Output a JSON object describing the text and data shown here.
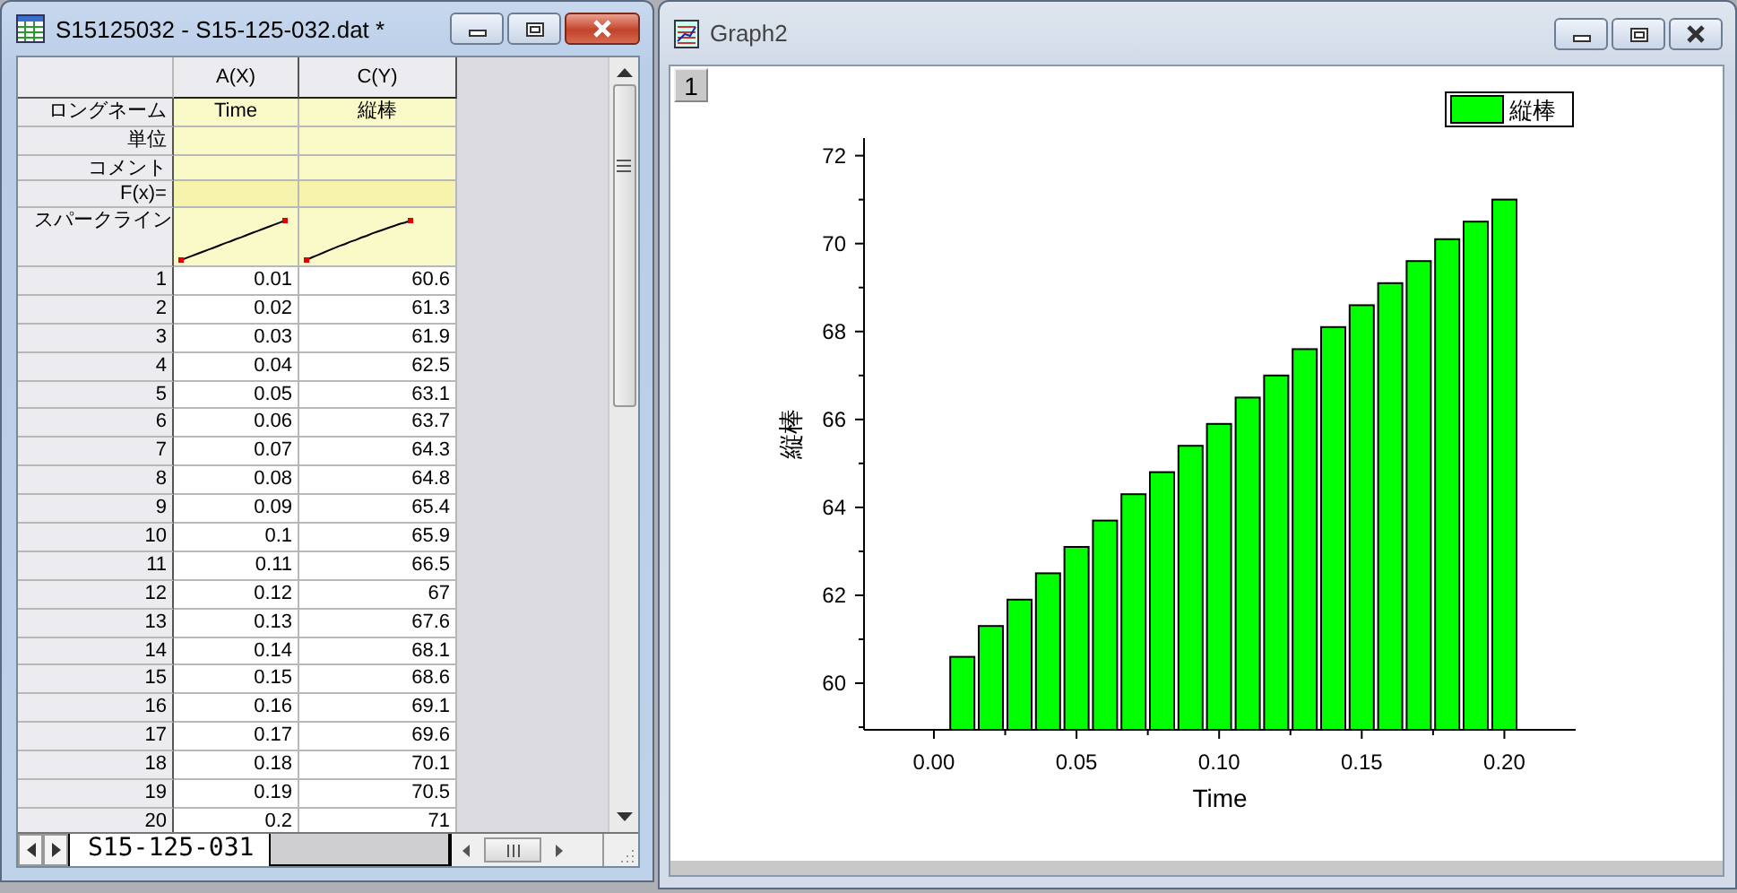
{
  "worksheet_window": {
    "title": "S15125032 - S15-125-032.dat *",
    "columns": [
      {
        "header": "A(X)",
        "long_name": "Time"
      },
      {
        "header": "C(Y)",
        "long_name": "縦棒"
      }
    ],
    "label_rows": [
      {
        "label": "ロングネーム",
        "kind": "text"
      },
      {
        "label": "単位",
        "kind": "text"
      },
      {
        "label": "コメント",
        "kind": "text"
      },
      {
        "label": "F(x)=",
        "kind": "formula"
      },
      {
        "label": "スパークライン",
        "kind": "sparkline"
      }
    ],
    "rows": [
      {
        "index": "1",
        "cells": [
          "0.01",
          "60.6"
        ]
      },
      {
        "index": "2",
        "cells": [
          "0.02",
          "61.3"
        ]
      },
      {
        "index": "3",
        "cells": [
          "0.03",
          "61.9"
        ]
      },
      {
        "index": "4",
        "cells": [
          "0.04",
          "62.5"
        ]
      },
      {
        "index": "5",
        "cells": [
          "0.05",
          "63.1"
        ]
      },
      {
        "index": "6",
        "cells": [
          "0.06",
          "63.7"
        ]
      },
      {
        "index": "7",
        "cells": [
          "0.07",
          "64.3"
        ]
      },
      {
        "index": "8",
        "cells": [
          "0.08",
          "64.8"
        ]
      },
      {
        "index": "9",
        "cells": [
          "0.09",
          "65.4"
        ]
      },
      {
        "index": "10",
        "cells": [
          "0.1",
          "65.9"
        ]
      },
      {
        "index": "11",
        "cells": [
          "0.11",
          "66.5"
        ]
      },
      {
        "index": "12",
        "cells": [
          "0.12",
          "67"
        ]
      },
      {
        "index": "13",
        "cells": [
          "0.13",
          "67.6"
        ]
      },
      {
        "index": "14",
        "cells": [
          "0.14",
          "68.1"
        ]
      },
      {
        "index": "15",
        "cells": [
          "0.15",
          "68.6"
        ]
      },
      {
        "index": "16",
        "cells": [
          "0.16",
          "69.1"
        ]
      },
      {
        "index": "17",
        "cells": [
          "0.17",
          "69.6"
        ]
      },
      {
        "index": "18",
        "cells": [
          "0.18",
          "70.1"
        ]
      },
      {
        "index": "19",
        "cells": [
          "0.19",
          "70.5"
        ]
      },
      {
        "index": "20",
        "cells": [
          "0.2",
          "71"
        ]
      }
    ],
    "sheet_tab": "S15-125-031"
  },
  "graph_window": {
    "title": "Graph2",
    "layer_button": "1",
    "chart_data": {
      "type": "bar",
      "xlabel": "Time",
      "ylabel": "縦棒",
      "x": [
        0.01,
        0.02,
        0.03,
        0.04,
        0.05,
        0.06,
        0.07,
        0.08,
        0.09,
        0.1,
        0.11,
        0.12,
        0.13,
        0.14,
        0.15,
        0.16,
        0.17,
        0.18,
        0.19,
        0.2
      ],
      "series": [
        {
          "name": "縦棒",
          "color": "#00ff00",
          "values": [
            60.6,
            61.3,
            61.9,
            62.5,
            63.1,
            63.7,
            64.3,
            64.8,
            65.4,
            65.9,
            66.5,
            67,
            67.6,
            68.1,
            68.6,
            69.1,
            69.6,
            70.1,
            70.5,
            71
          ]
        }
      ],
      "xlim": [
        -0.0245,
        0.225
      ],
      "ylim": [
        58.94,
        72.4
      ],
      "xticks": [
        {
          "value": 0,
          "label": "0.00"
        },
        {
          "value": 0.05,
          "label": "0.05"
        },
        {
          "value": 0.1,
          "label": "0.10"
        },
        {
          "value": 0.15,
          "label": "0.15"
        },
        {
          "value": 0.2,
          "label": "0.20"
        }
      ],
      "yticks": [
        60,
        62,
        64,
        66,
        68,
        70,
        72
      ]
    }
  }
}
